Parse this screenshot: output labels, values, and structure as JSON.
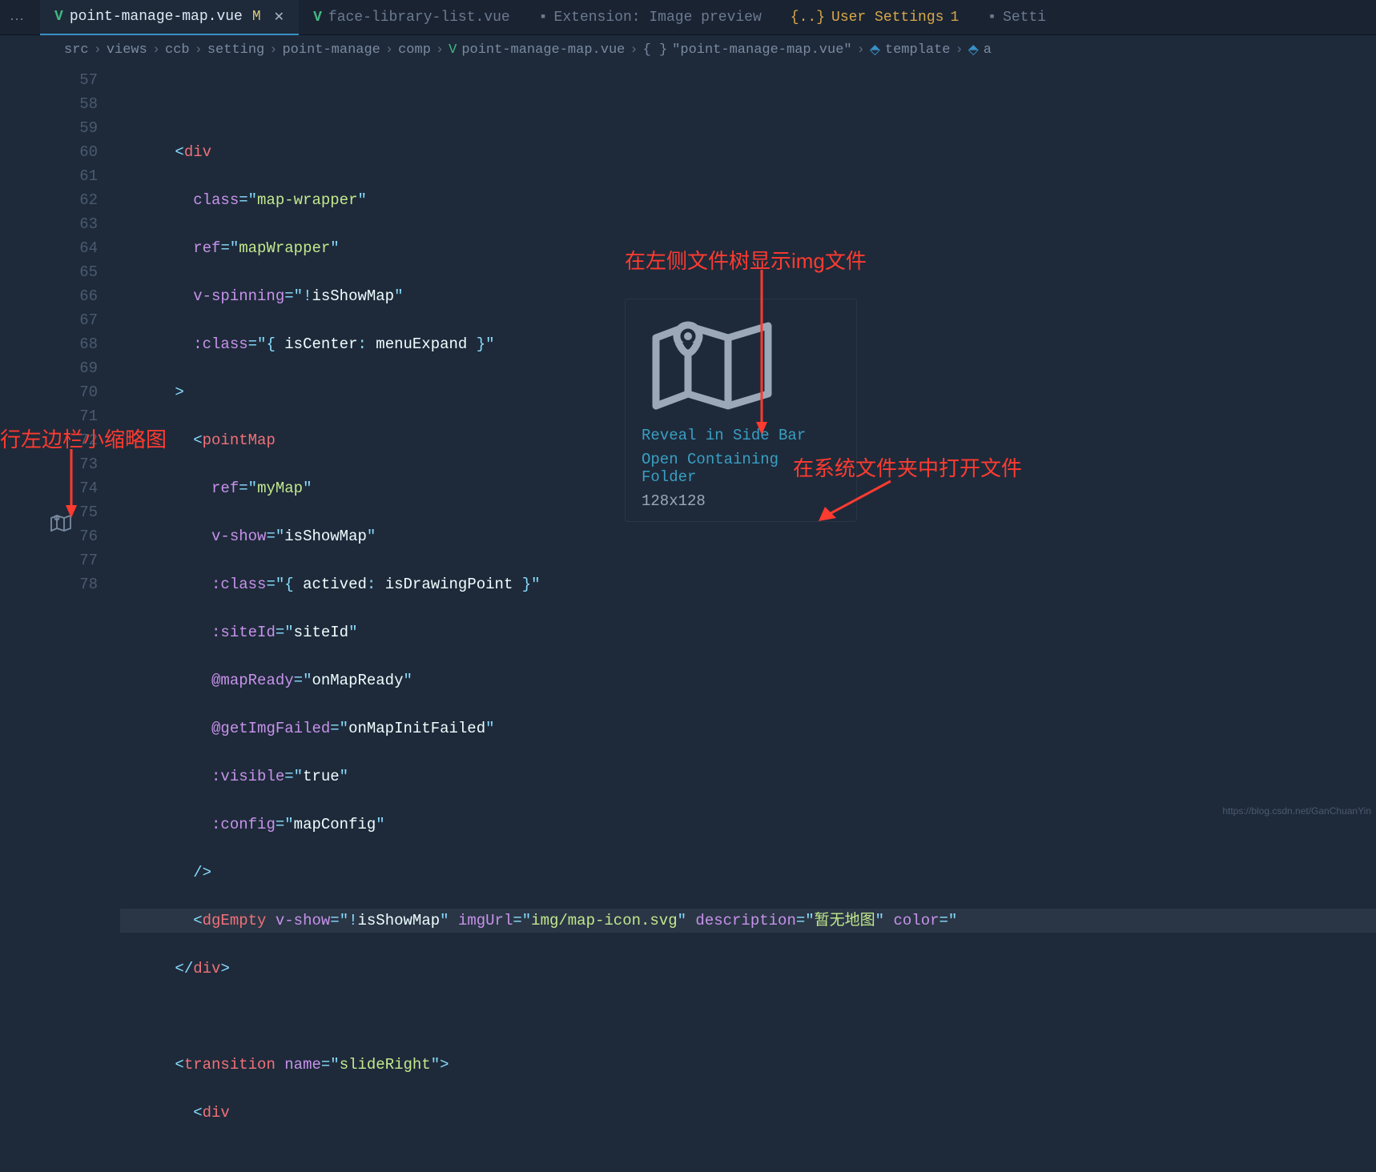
{
  "tabs": [
    {
      "icon": "vue",
      "label": "point-manage-map.vue",
      "modified": "M",
      "active": true,
      "close": true
    },
    {
      "icon": "vue",
      "label": "face-library-list.vue"
    },
    {
      "icon": "ext",
      "label": "Extension: Image preview"
    },
    {
      "icon": "settings",
      "label": "User Settings",
      "badge": "1",
      "settings_style": true
    },
    {
      "icon": "ext",
      "label": "Setti"
    }
  ],
  "breadcrumb": {
    "parts": [
      "src",
      "views",
      "ccb",
      "setting",
      "point-manage",
      "comp"
    ],
    "file": "point-manage-map.vue",
    "symbol": "\"point-manage-map.vue\"",
    "tpl": "template",
    "last": "a"
  },
  "gutter_lines": [
    "57",
    "58",
    "59",
    "60",
    "61",
    "62",
    "63",
    "64",
    "65",
    "66",
    "67",
    "68",
    "69",
    "70",
    "71",
    "72",
    "73",
    "74",
    "75",
    "76",
    "77",
    "78"
  ],
  "code": {
    "l57": "",
    "l58": {
      "tag": "div"
    },
    "l59": {
      "attr": "class",
      "val": "map-wrapper"
    },
    "l60": {
      "attr": "ref",
      "val": "mapWrapper"
    },
    "l61": {
      "attr": "v-spinning",
      "expr_pre": "!",
      "expr": "isShowMap"
    },
    "l62": {
      "attr": ":class",
      "expr": "{ isCenter: menuExpand }"
    },
    "l63": ">",
    "l64": {
      "tag": "pointMap"
    },
    "l65": {
      "attr": "ref",
      "val": "myMap"
    },
    "l66": {
      "attr": "v-show",
      "expr": "isShowMap"
    },
    "l67": {
      "attr": ":class",
      "expr": "{ actived: isDrawingPoint }"
    },
    "l68": {
      "attr": ":siteId",
      "expr": "siteId"
    },
    "l69": {
      "attr": "@mapReady",
      "expr": "onMapReady"
    },
    "l70": {
      "attr": "@getImgFailed",
      "expr": "onMapInitFailed"
    },
    "l71": {
      "attr": ":visible",
      "expr": "true"
    },
    "l72": {
      "attr": ":config",
      "expr": "mapConfig"
    },
    "l73": "/>",
    "l74": {
      "tag": "dgEmpty",
      "attr1": "v-show",
      "expr1_pre": "!",
      "expr1": "isShowMap",
      "attr2": "imgUrl",
      "val2": "img/map-icon.svg",
      "attr3": "description",
      "val3": "暂无地图",
      "attr4": "color"
    },
    "l75": {
      "close": "div"
    },
    "l76": "",
    "l77": {
      "tag": "transition",
      "attr": "name",
      "val": "slideRight",
      "close": ">"
    },
    "l78": {
      "tag": "div"
    }
  },
  "popup": {
    "link1": "Reveal in Side Bar",
    "link2": "Open Containing Folder",
    "dim": "128x128"
  },
  "annotations": {
    "a1": "行左边栏小缩略图",
    "a2": "在左侧文件树显示img文件",
    "a3": "在系统文件夹中打开文件"
  },
  "watermark": "https://blog.csdn.net/GanChuanYin"
}
